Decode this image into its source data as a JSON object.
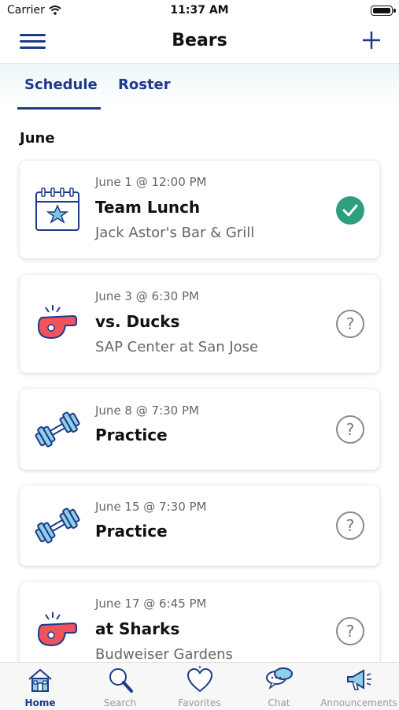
{
  "status_bar": {
    "carrier": "Carrier",
    "time": "11:37 AM"
  },
  "nav": {
    "title": "Bears"
  },
  "tabs": [
    {
      "label": "Schedule",
      "active": true
    },
    {
      "label": "Roster",
      "active": false
    }
  ],
  "section": {
    "title": "June"
  },
  "events": [
    {
      "date": "June 1 @ 12:00 PM",
      "title": "Team Lunch",
      "location": "Jack Astor's Bar & Grill",
      "icon": "calendar-star-icon",
      "rsvp": "confirmed"
    },
    {
      "date": "June 3 @ 6:30 PM",
      "title": "vs. Ducks",
      "location": "SAP Center at San Jose",
      "icon": "whistle-icon",
      "rsvp": "unknown"
    },
    {
      "date": "June 8 @ 7:30 PM",
      "title": "Practice",
      "location": "",
      "icon": "dumbbell-icon",
      "rsvp": "unknown"
    },
    {
      "date": "June 15 @ 7:30 PM",
      "title": "Practice",
      "location": "",
      "icon": "dumbbell-icon",
      "rsvp": "unknown"
    },
    {
      "date": "June 17 @ 6:45 PM",
      "title": "at Sharks",
      "location": "Budweiser Gardens",
      "icon": "whistle-icon",
      "rsvp": "unknown"
    }
  ],
  "rsvp_unknown_symbol": "?",
  "tabbar": [
    {
      "label": "Home",
      "icon": "home-icon",
      "active": true
    },
    {
      "label": "Search",
      "icon": "search-icon",
      "active": false
    },
    {
      "label": "Favorites",
      "icon": "heart-icon",
      "active": false
    },
    {
      "label": "Chat",
      "icon": "chat-icon",
      "active": false
    },
    {
      "label": "Announcements",
      "icon": "megaphone-icon",
      "active": false
    }
  ],
  "colors": {
    "primary": "#1e3a8a",
    "accent_red": "#f0535a",
    "confirmed_green": "#2e9e7e",
    "muted_text": "#666666"
  }
}
